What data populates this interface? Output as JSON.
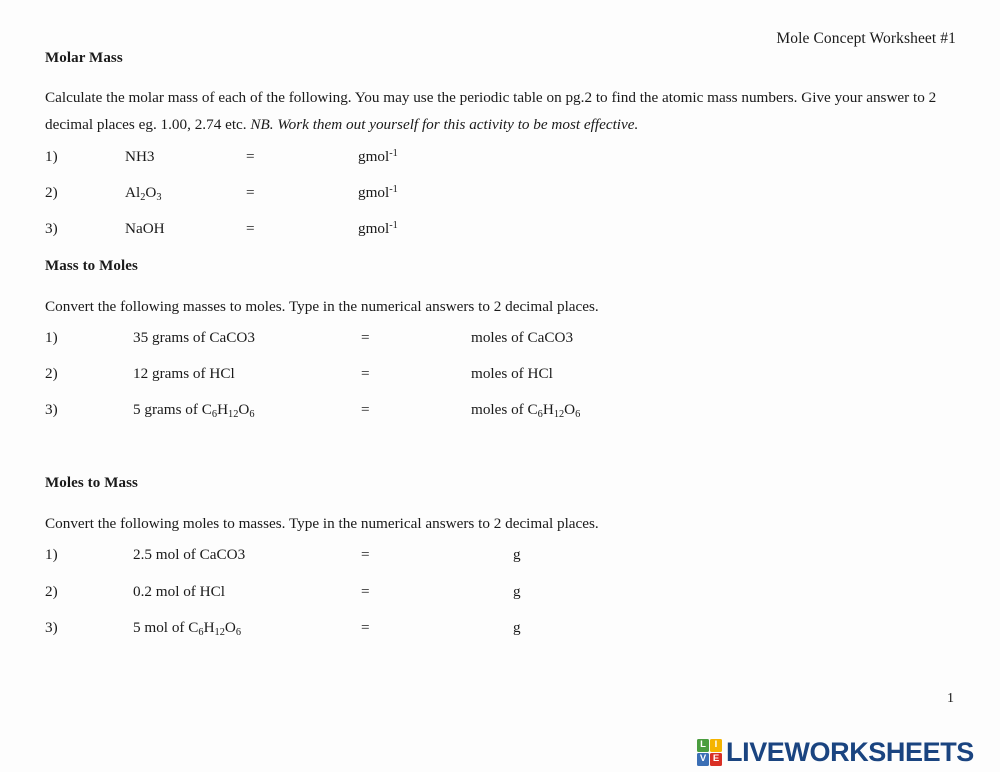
{
  "document": {
    "header_title": "Mole Concept Worksheet #1",
    "page_number": "1"
  },
  "sections": [
    {
      "heading": "Molar Mass",
      "instructions_plain": "Calculate the molar mass of each of the following. You may use the periodic table on pg.2 to find the atomic mass numbers. Give your answer to 2 decimal places eg. 1.00, 2.74 etc. ",
      "instructions_italic": "NB. Work them out yourself for this activity to be most effective.",
      "items": [
        {
          "number": "1)",
          "equals": "=",
          "unit": "gmol"
        },
        {
          "number": "2)",
          "equals": "=",
          "unit": "gmol"
        },
        {
          "number": "3)",
          "equals": "=",
          "unit": "gmol"
        }
      ],
      "unit_superscript": "-1",
      "formulas": [
        {
          "text": "NH3"
        },
        {
          "text": "Al2O3"
        },
        {
          "text": "NaOH"
        }
      ]
    },
    {
      "heading": "Mass to Moles",
      "instructions_plain": "Convert the following masses to moles. Type in the numerical answers to 2 decimal places.",
      "items": [
        {
          "number": "1)",
          "quantity": "35 grams of ",
          "compound": "CaCO3",
          "equals": "=",
          "answer_prefix": "moles of ",
          "answer_compound": "CaCO3"
        },
        {
          "number": "2)",
          "quantity": "12 grams of ",
          "compound": "HCl",
          "equals": "=",
          "answer_prefix": "moles of ",
          "answer_compound": "HCl"
        },
        {
          "number": "3)",
          "quantity": "5 grams of ",
          "compound": "C6H12O6",
          "equals": "=",
          "answer_prefix": "moles of ",
          "answer_compound": "C6H12O6"
        }
      ]
    },
    {
      "heading": "Moles to Mass",
      "instructions_plain": "Convert the following moles to masses. Type in the numerical answers to 2 decimal places.",
      "items": [
        {
          "number": "1)",
          "quantity": "2.5 mol of ",
          "compound": "CaCO3",
          "equals": "=",
          "unit": "g"
        },
        {
          "number": "2)",
          "quantity": "0.2 mol of ",
          "compound": "HCl",
          "equals": "=",
          "unit": "g"
        },
        {
          "number": "3)",
          "quantity": "5 mol of ",
          "compound": "C6H12O6",
          "equals": "=",
          "unit": "g"
        }
      ]
    }
  ],
  "logo": {
    "tiles": [
      {
        "letter": "L",
        "color": "#4a9d3f"
      },
      {
        "letter": "I",
        "color": "#f5b400"
      },
      {
        "letter": "V",
        "color": "#3b6fb5"
      },
      {
        "letter": "E",
        "color": "#d93025"
      }
    ],
    "wordmark": "LIVEWORKSHEETS",
    "wordmark_color": "#1a4480"
  }
}
